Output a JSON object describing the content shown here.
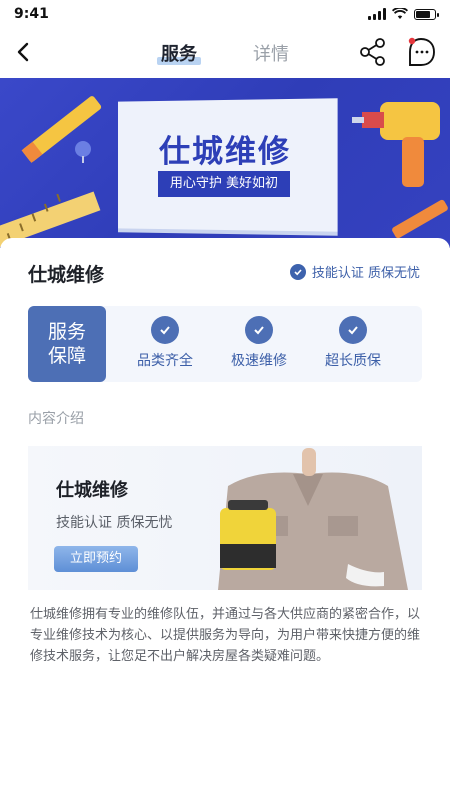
{
  "status_bar": {
    "time": "9:41",
    "battery_level": 0.9
  },
  "nav": {
    "tabs": [
      {
        "label": "服务",
        "active": true
      },
      {
        "label": "详情",
        "active": false
      }
    ]
  },
  "banner": {
    "title": "仕城维修",
    "subtitle": "用心守护  美好如初"
  },
  "shop": {
    "name": "仕城维修",
    "cert_text": "技能认证 质保无忧"
  },
  "guarantee": {
    "label": "服务保障",
    "items": [
      {
        "label": "品类齐全"
      },
      {
        "label": "极速维修"
      },
      {
        "label": "超长质保"
      }
    ]
  },
  "section": {
    "title": "内容介绍"
  },
  "promo": {
    "title": "仕城维修",
    "subtitle": "技能认证 质保无忧",
    "button": "立即预约"
  },
  "description": "仕城维修拥有专业的维修队伍，并通过与各大供应商的紧密合作，以专业维修技术为核心、以提供服务为导向，为用户带来快捷方便的维修技术服务，让您足不出户解决房屋各类疑难问题。",
  "colors": {
    "accent": "#4d6fb5",
    "banner_bg": "#3340c0",
    "text_primary": "#1e2128"
  }
}
